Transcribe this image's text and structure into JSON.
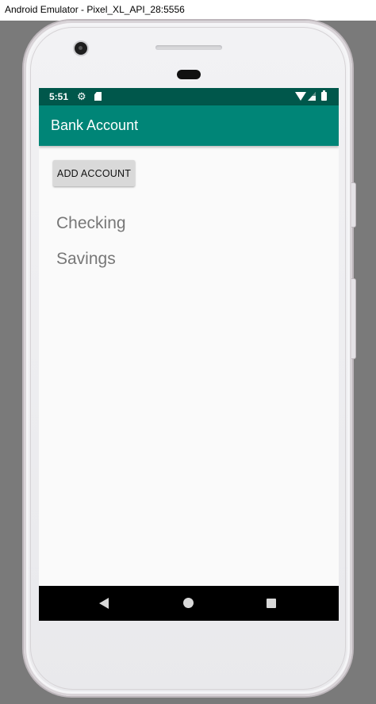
{
  "window": {
    "title": "Android Emulator - Pixel_XL_API_28:5556"
  },
  "status_bar": {
    "time": "5:51"
  },
  "app_bar": {
    "title": "Bank Account"
  },
  "main": {
    "add_account_label": "ADD ACCOUNT",
    "accounts": [
      "Checking",
      "Savings"
    ]
  },
  "icons": {
    "status": [
      "gear-icon",
      "sd-card-icon",
      "wifi-icon",
      "signal-icon",
      "battery-icon"
    ],
    "nav": [
      "back-icon",
      "home-icon",
      "recents-icon"
    ]
  },
  "colors": {
    "status_bar": "#00574b",
    "app_bar": "#008577",
    "background": "#fafafa",
    "button": "#d9d9d9",
    "nav_bar": "#000000"
  }
}
